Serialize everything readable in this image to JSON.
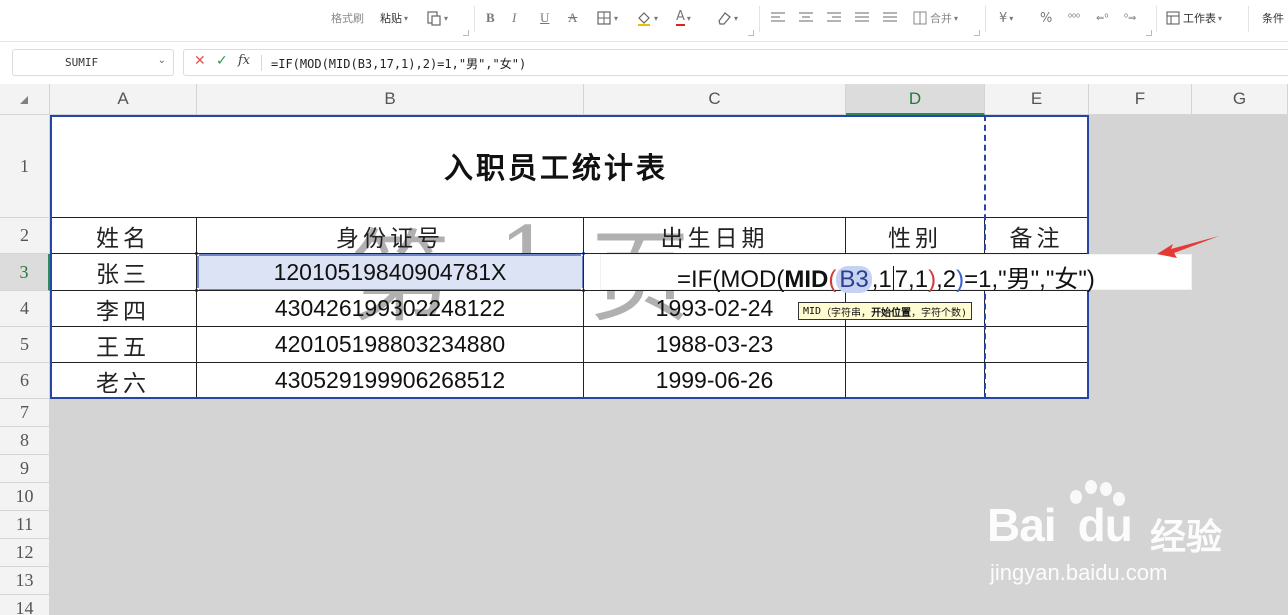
{
  "toolbar": {
    "format_painter": "格式刷",
    "paste": "粘贴",
    "merge": "合并",
    "worksheet": "工作表",
    "conditional": "条件",
    "icons": {
      "paste_special": "clipboard-icon",
      "bold": "B",
      "italic": "I",
      "underline": "U",
      "strikethrough": "A",
      "borders": "border-icon",
      "fill": "fill-color-icon",
      "font_color": "A",
      "clear": "eraser-icon",
      "currency": "¥",
      "percent": "%"
    }
  },
  "namebox": {
    "value": "SUMIF"
  },
  "formula_bar": {
    "formula": "=IF(MOD(MID(B3,17,1),2)=1,\"男\",\"女\")"
  },
  "columns": [
    "A",
    "B",
    "C",
    "D",
    "E",
    "F",
    "G"
  ],
  "rows": [
    "1",
    "2",
    "3",
    "4",
    "5",
    "6",
    "7",
    "8",
    "9",
    "10",
    "11",
    "12",
    "13",
    "14"
  ],
  "table": {
    "title": "入职员工统计表",
    "headers": [
      "姓名",
      "身份证号",
      "出生日期",
      "性别",
      "备注"
    ],
    "rows": [
      {
        "name": "张三",
        "id": "12010519840904781X",
        "dob": ""
      },
      {
        "name": "李四",
        "id": "430426199302248122",
        "dob": "1993-02-24"
      },
      {
        "name": "王五",
        "id": "420105198803234880",
        "dob": "1988-03-23"
      },
      {
        "name": "老六",
        "id": "430529199906268512",
        "dob": "1999-06-26"
      }
    ]
  },
  "page_watermark": {
    "char1": "第",
    "char2": "1",
    "char3": "页"
  },
  "editing": {
    "prefix": "=IF(MOD(",
    "mid_fn": "MID",
    "open_paren": "(",
    "ref": "B3",
    "arg_a": ",1",
    "arg_b": "7,1",
    "close_paren": ")",
    "middle": ",2",
    "close_mod": ")",
    "suffix": "=1,\"男\",\"女\")"
  },
  "tooltip": {
    "fn": "MID",
    "open": "（字符串，",
    "bold_arg": "开始位置",
    "rest": "，字符个数)"
  },
  "baidu": {
    "logo_a": "Bai",
    "logo_b": "du",
    "jingyan": "经验",
    "url": "jingyan.baidu.com"
  },
  "colors": {
    "accent_green": "#2e8b57",
    "print_blue": "#2546a8",
    "arrow_red": "#e53935"
  }
}
